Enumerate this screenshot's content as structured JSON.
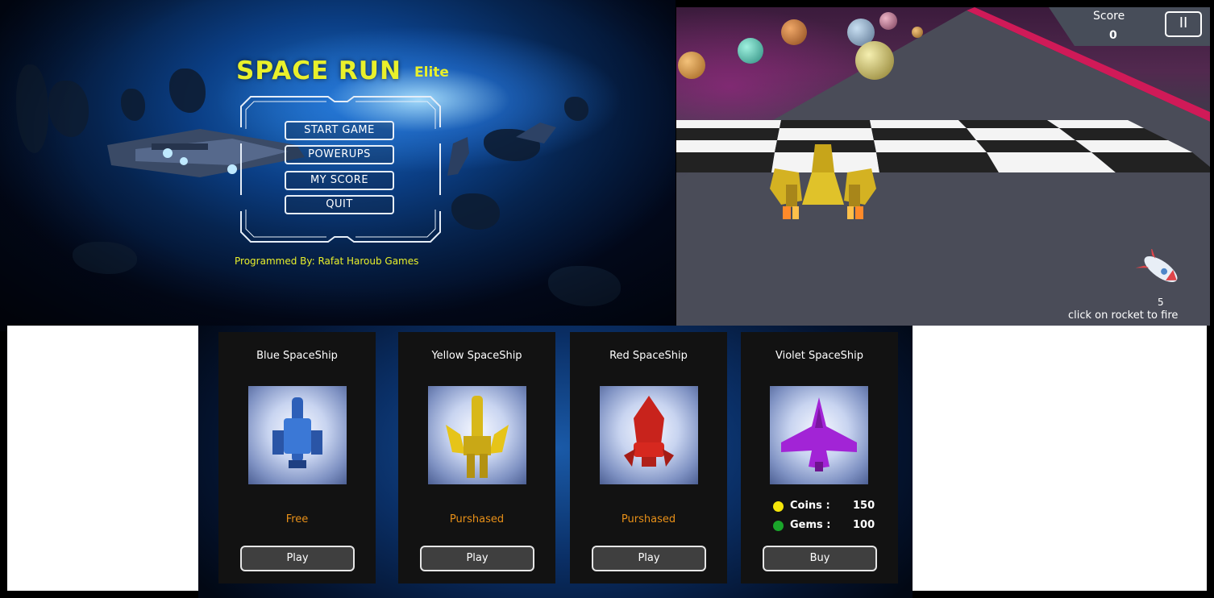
{
  "menu": {
    "title": "SPACE RUN",
    "title_sub": "Elite",
    "buttons": [
      "START GAME",
      "POWERUPS",
      "MY SCORE",
      "QUIT"
    ],
    "credit": "Programmed By: Rafat Haroub Games"
  },
  "game": {
    "score_label": "Score",
    "score_value": "0",
    "pause_symbol": "II",
    "rocket_count": "5",
    "fire_hint": "click on rocket to fire"
  },
  "ships": [
    {
      "title": "Blue SpaceShip",
      "status": "Free",
      "button": "Play",
      "color": "#2f6fd6"
    },
    {
      "title": "Yellow SpaceShip",
      "status": "Purshased",
      "button": "Play",
      "color": "#e6c419"
    },
    {
      "title": "Red SpaceShip",
      "status": "Purshased",
      "button": "Play",
      "color": "#d6281f"
    },
    {
      "title": "Violet SpaceShip",
      "status": "",
      "button": "Buy",
      "color": "#a224d6",
      "cost": {
        "coins_label": "Coins :",
        "coins": "150",
        "gems_label": "Gems :",
        "gems": "100"
      }
    }
  ],
  "colors": {
    "accent_yellow": "#e9f02b",
    "status_orange": "#e89018",
    "coin": "#f5e60a",
    "gem": "#1aa52a"
  }
}
